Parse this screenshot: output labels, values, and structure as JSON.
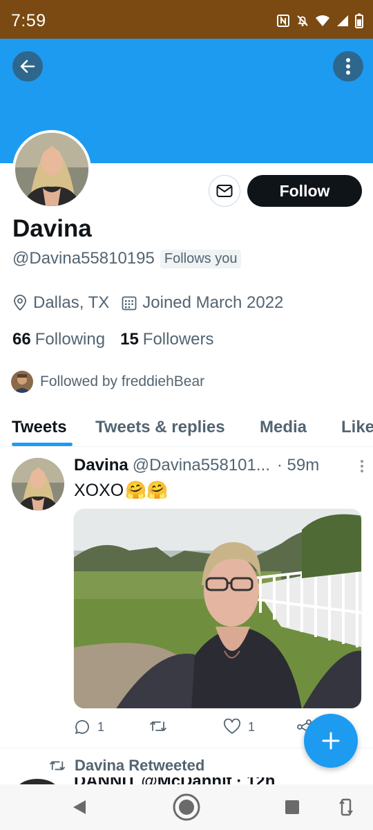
{
  "status_bar": {
    "time": "7:59"
  },
  "header": {
    "back_icon": "arrow-left-icon",
    "more_icon": "vertical-dots-icon"
  },
  "profile": {
    "name": "Davina",
    "handle": "@Davina55810195",
    "follows_you": "Follows you",
    "follow_label": "Follow",
    "location": "Dallas, TX",
    "joined": "Joined March 2022",
    "following_count": "66",
    "following_label": "Following",
    "followers_count": "15",
    "followers_label": "Followers",
    "followed_by": "Followed by freddiehBear"
  },
  "tabs": [
    {
      "label": "Tweets",
      "active": true
    },
    {
      "label": "Tweets & replies",
      "active": false
    },
    {
      "label": "Media",
      "active": false
    },
    {
      "label": "Like",
      "active": false
    }
  ],
  "tweet": {
    "name": "Davina",
    "handle": "@Davina558101...",
    "time": "· 59m",
    "text": "XOXO",
    "emoji": "🤗🤗",
    "reply_count": "1",
    "retweet_count": "",
    "like_count": "1"
  },
  "next_item": {
    "retweeted_label": "Davina Retweeted",
    "partial_text": "DANNIT @McDannit · 12h"
  },
  "colors": {
    "accent": "#1d9bf0",
    "status_bar": "#7a4a12",
    "text": "#0f1419",
    "muted": "#536471"
  }
}
